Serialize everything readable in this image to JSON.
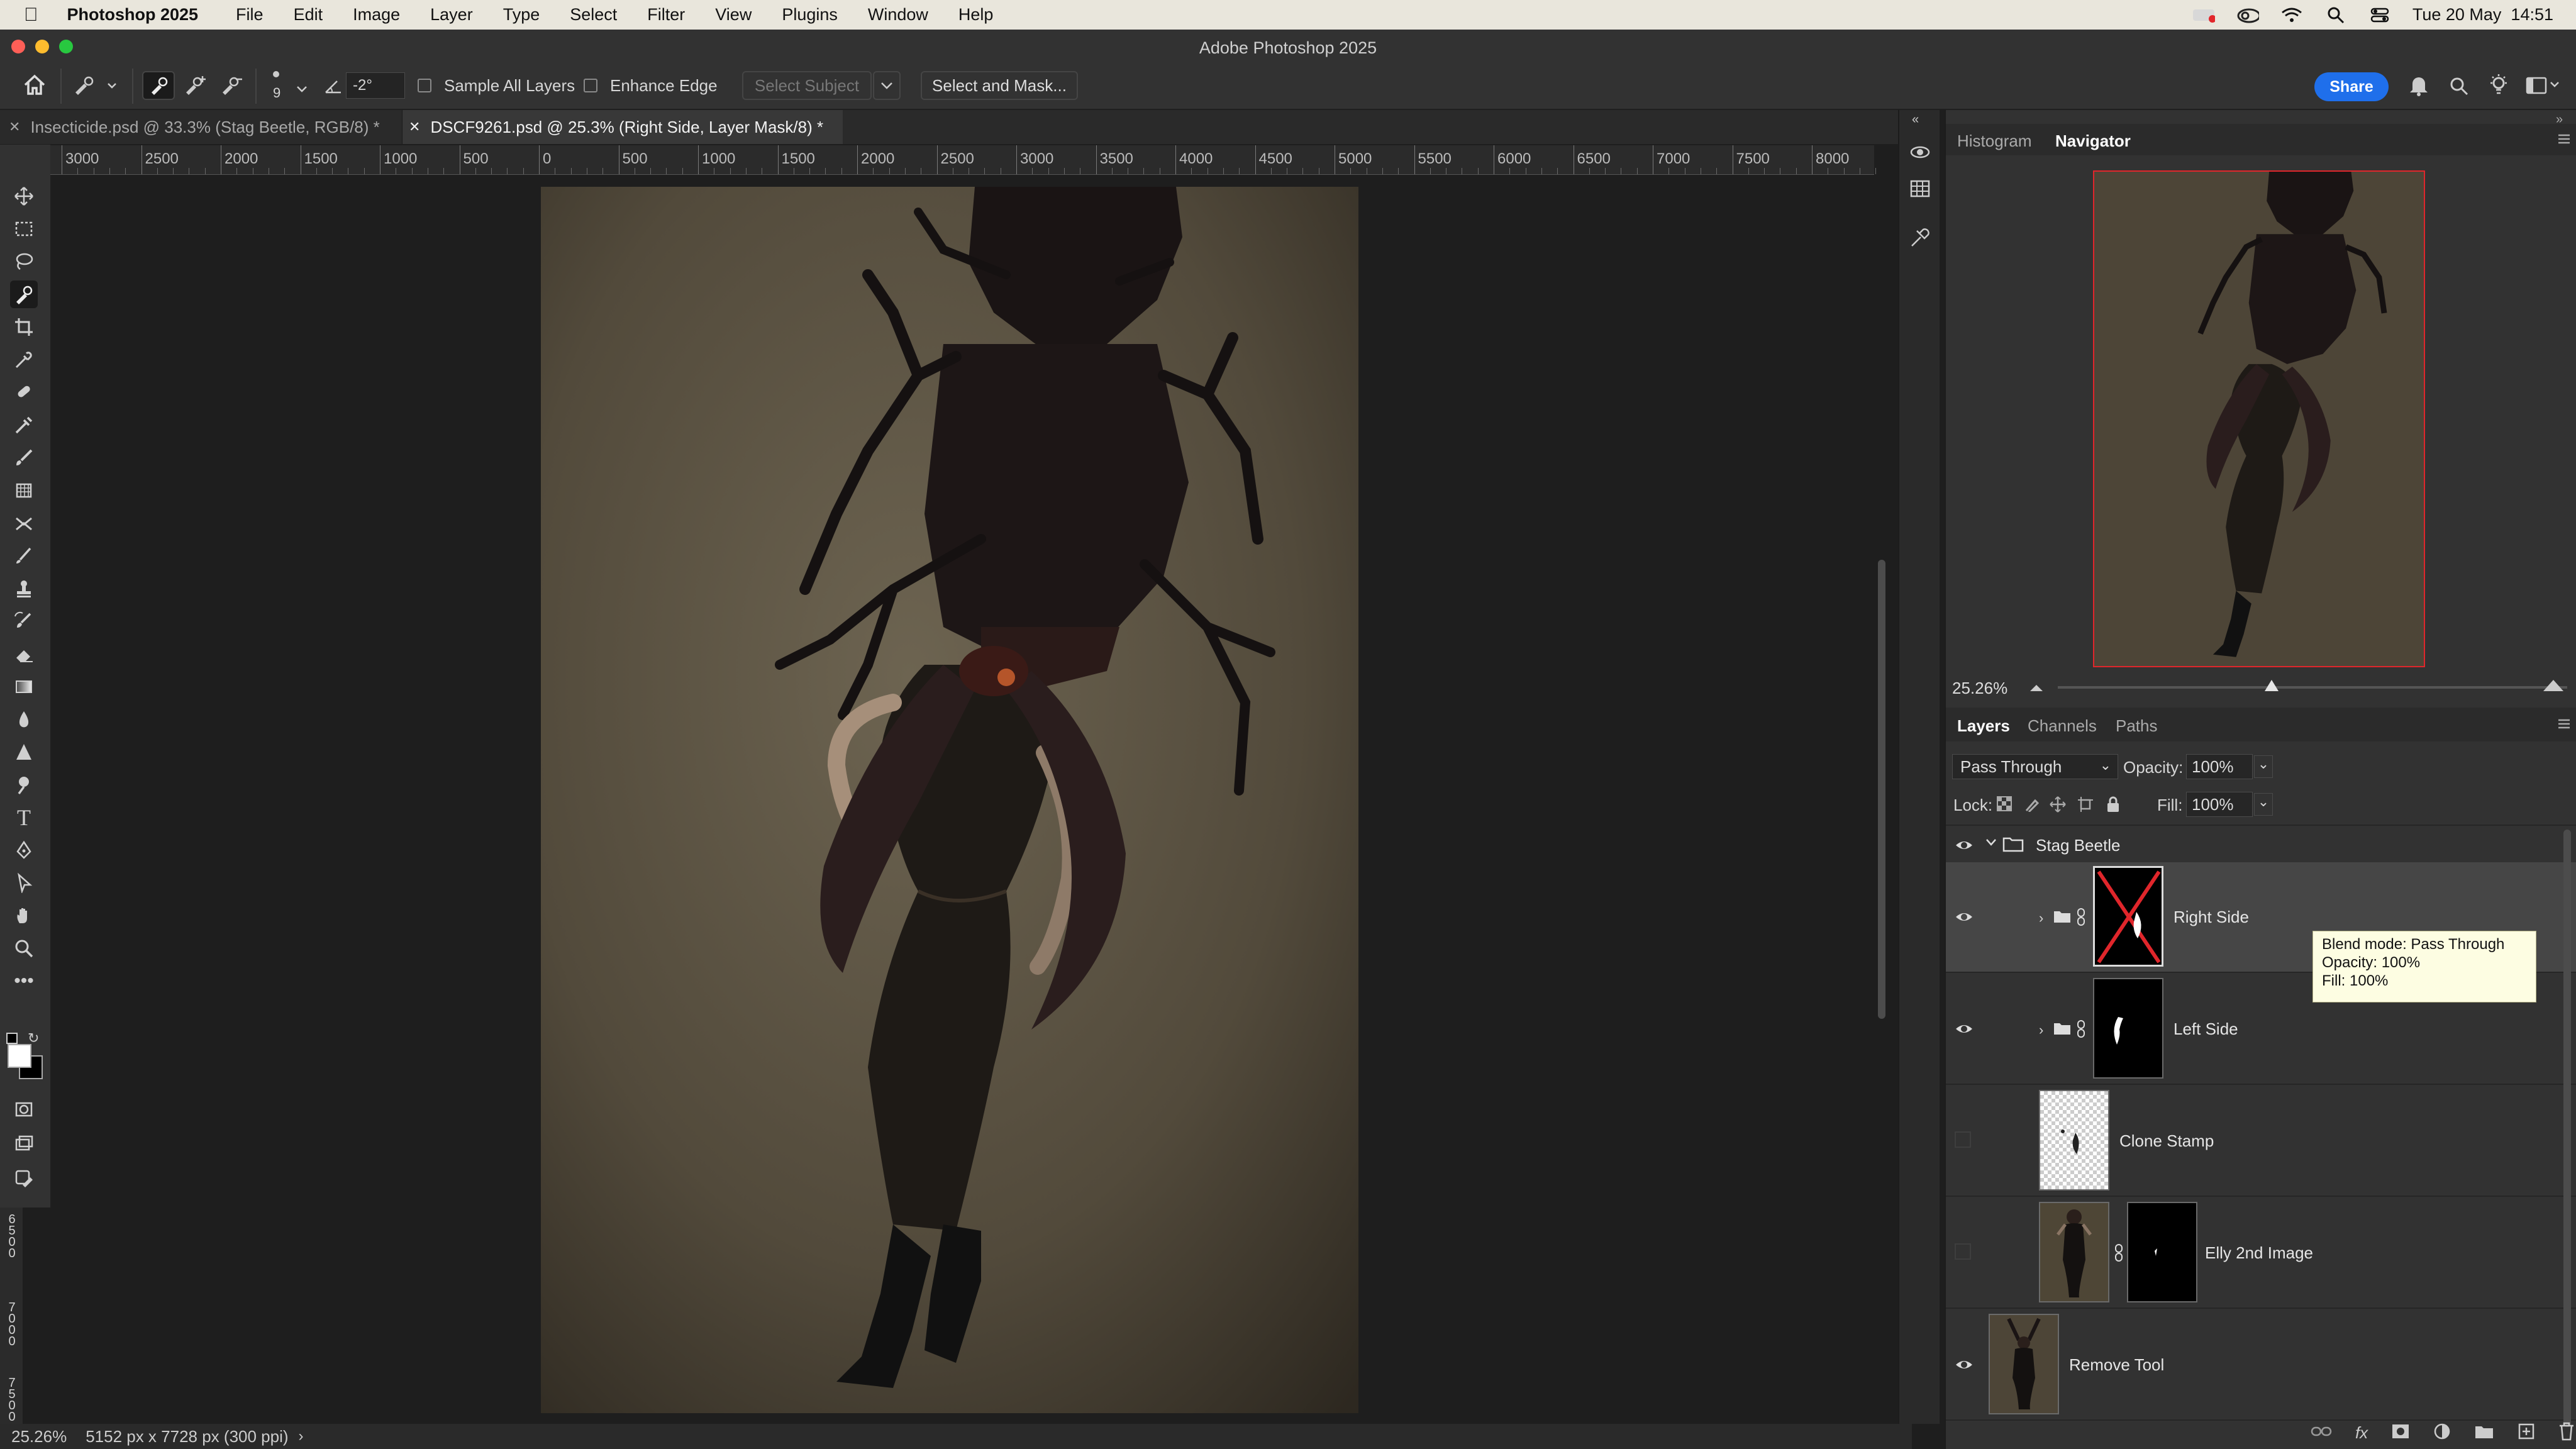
{
  "menubar": {
    "apple_icon": "apple-logo-icon",
    "app_name": "Photoshop 2025",
    "items": [
      "File",
      "Edit",
      "Image",
      "Layer",
      "Type",
      "Select",
      "Filter",
      "View",
      "Plugins",
      "Window",
      "Help"
    ],
    "clock": "Tue 20 May  14:51"
  },
  "window": {
    "title": "Adobe Photoshop 2025"
  },
  "options": {
    "brush_size": "9",
    "angle_value": "-2°",
    "sample_all_layers": "Sample All Layers",
    "enhance_edge": "Enhance Edge",
    "select_subject": "Select Subject",
    "select_and_mask": "Select and Mask...",
    "share": "Share"
  },
  "tabs": [
    {
      "label": "Insecticide.psd @ 33.3% (Stag Beetle, RGB/8) *",
      "active": false
    },
    {
      "label": "DSCF9261.psd @ 25.3% (Right Side, Layer Mask/8) *",
      "active": true
    }
  ],
  "ruler": {
    "ticks": [
      "3000",
      "2500",
      "2000",
      "1500",
      "1000",
      "500",
      "0",
      "500",
      "1000",
      "1500",
      "2000",
      "2500",
      "3000",
      "3500",
      "4000",
      "4500",
      "5000",
      "5500",
      "6000",
      "6500",
      "7000",
      "7500",
      "8000"
    ]
  },
  "vruler": {
    "ticks": [
      "6500",
      "7000",
      "7500"
    ]
  },
  "status": {
    "zoom": "25.26%",
    "doc_info": "5152 px x 7728 px (300 ppi)"
  },
  "navigator": {
    "tabs": [
      "Histogram",
      "Navigator"
    ],
    "active_tab": "Navigator",
    "zoom": "25.26%",
    "slider_fraction": 0.42
  },
  "layers_panel": {
    "tabs": [
      "Layers",
      "Channels",
      "Paths"
    ],
    "active_tab": "Layers",
    "blend_mode": "Pass Through",
    "opacity_label": "Opacity:",
    "opacity": "100%",
    "lock_label": "Lock:",
    "fill_label": "Fill:",
    "fill": "100%",
    "group_name": "Stag Beetle",
    "layers": [
      {
        "name": "Right Side",
        "visible": true,
        "selected": true
      },
      {
        "name": "Left Side",
        "visible": true,
        "selected": false
      },
      {
        "name": "Clone Stamp",
        "visible": false,
        "selected": false
      },
      {
        "name": "Elly 2nd Image",
        "visible": false,
        "selected": false
      },
      {
        "name": "Remove Tool",
        "visible": true,
        "selected": false
      }
    ]
  },
  "tooltip": {
    "line1": "Blend mode: Pass Through",
    "line2": "Opacity: 100%",
    "line3": "Fill: 100%"
  },
  "colors": {
    "accent": "#1f6feb",
    "mask_cross": "#e0262b",
    "nav_frame": "#e0262b"
  }
}
